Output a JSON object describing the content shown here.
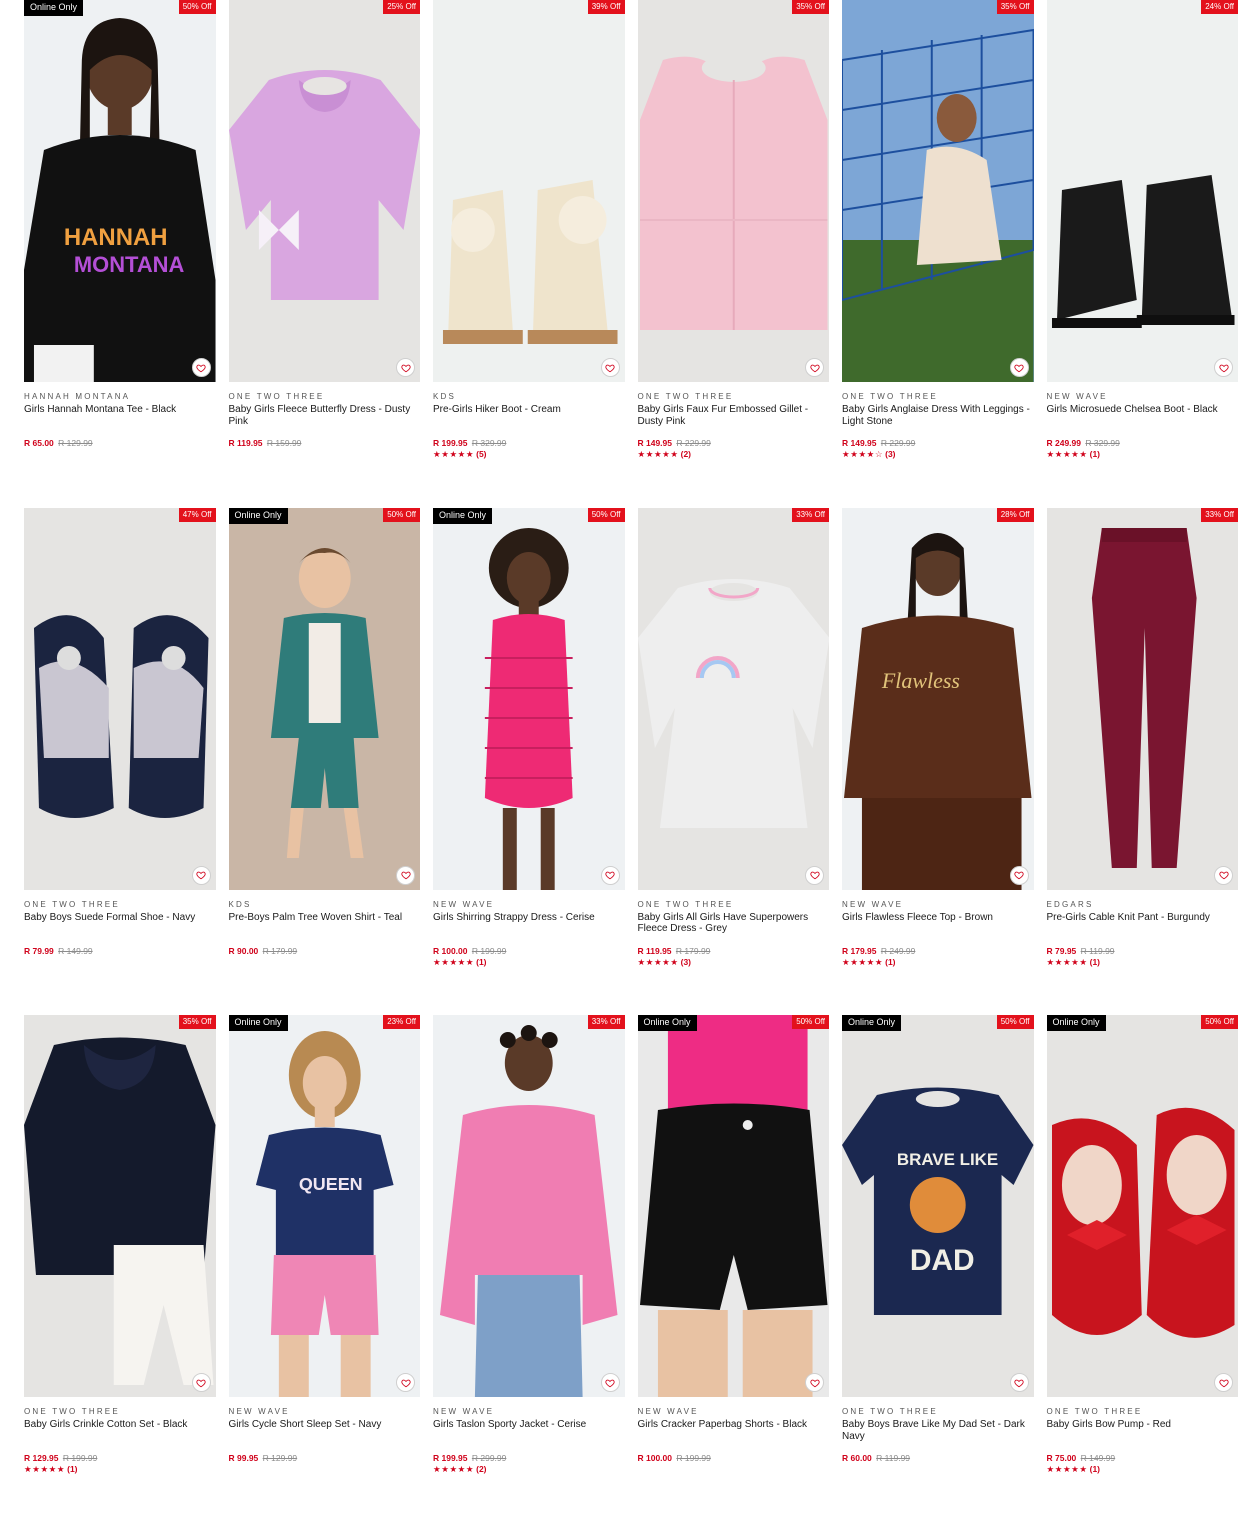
{
  "colors": {
    "sale_red": "#e3111c",
    "price_red": "#d0021b",
    "badge_black": "#000000"
  },
  "icons": {
    "wishlist": "heart-outline-icon",
    "rating": "star-icon"
  },
  "products": [
    {
      "id": "p1",
      "brand": "HANNAH MONTANA",
      "name": "Girls Hannah Montana Tee - Black",
      "price": "R 65.00",
      "was": "R 129.99",
      "discount": "50% Off",
      "online_only": "Online Only",
      "stars": "",
      "reviews": "",
      "bg": "#eef1f3",
      "art": "girl-tee"
    },
    {
      "id": "p2",
      "brand": "ONE TWO THREE",
      "name": "Baby Girls Fleece Butterfly Dress - Dusty Pink",
      "price": "R 119.95",
      "was": "R 159.99",
      "discount": "25% Off",
      "online_only": "",
      "stars": "",
      "reviews": "",
      "bg": "#e5e4e2",
      "art": "pink-dress"
    },
    {
      "id": "p3",
      "brand": "KDS",
      "name": "Pre-Girls Hiker Boot - Cream",
      "price": "R 199.95",
      "was": "R 329.99",
      "discount": "39% Off",
      "online_only": "",
      "stars": "★★★★★",
      "reviews": "(5)",
      "bg": "#eef1f0",
      "art": "boots-cream"
    },
    {
      "id": "p4",
      "brand": "ONE TWO THREE",
      "name": "Baby Girls Faux Fur Embossed Gillet - Dusty Pink",
      "price": "R 149.95",
      "was": "R 229.99",
      "discount": "35% Off",
      "online_only": "",
      "stars": "★★★★★",
      "reviews": "(2)",
      "bg": "#e5e4e2",
      "art": "pink-gillet"
    },
    {
      "id": "p5",
      "brand": "ONE TWO THREE",
      "name": "Baby Girls Anglaise Dress With Leggings - Light Stone",
      "price": "R 149.95",
      "was": "R 229.99",
      "discount": "35% Off",
      "online_only": "",
      "stars": "★★★★☆",
      "reviews": "(3)",
      "bg": "#7da6d6",
      "art": "playground"
    },
    {
      "id": "p6",
      "brand": "NEW WAVE",
      "name": "Girls Microsuede Chelsea Boot - Black",
      "price": "R 249.99",
      "was": "R 329.99",
      "discount": "24% Off",
      "online_only": "",
      "stars": "★★★★★",
      "reviews": "(1)",
      "bg": "#eef1f0",
      "art": "boots-black"
    },
    {
      "id": "p7",
      "brand": "ONE TWO THREE",
      "name": "Baby Boys Suede Formal Shoe - Navy",
      "price": "R 79.99",
      "was": "R 149.99",
      "discount": "47% Off",
      "online_only": "",
      "stars": "",
      "reviews": "",
      "bg": "#e5e4e2",
      "art": "navy-shoes"
    },
    {
      "id": "p8",
      "brand": "KDS",
      "name": "Pre-Boys Palm Tree Woven Shirt - Teal",
      "price": "R 90.00",
      "was": "R 179.99",
      "discount": "50% Off",
      "online_only": "Online Only",
      "stars": "",
      "reviews": "",
      "bg": "#c9b6a6",
      "art": "boy-teal"
    },
    {
      "id": "p9",
      "brand": "NEW WAVE",
      "name": "Girls Shirring Strappy Dress - Cerise",
      "price": "R 100.00",
      "was": "R 199.99",
      "discount": "50% Off",
      "online_only": "Online Only",
      "stars": "★★★★★",
      "reviews": "(1)",
      "bg": "#eef1f3",
      "art": "cerise-dress"
    },
    {
      "id": "p10",
      "brand": "ONE TWO THREE",
      "name": "Baby Girls All Girls Have Superpowers Fleece Dress - Grey",
      "price": "R 119.95",
      "was": "R 179.99",
      "discount": "33% Off",
      "online_only": "",
      "stars": "★★★★★",
      "reviews": "(3)",
      "bg": "#e5e4e2",
      "art": "grey-dress"
    },
    {
      "id": "p11",
      "brand": "NEW WAVE",
      "name": "Girls Flawless Fleece Top - Brown",
      "price": "R 179.95",
      "was": "R 249.99",
      "discount": "28% Off",
      "online_only": "",
      "stars": "★★★★★",
      "reviews": "(1)",
      "bg": "#eef1f3",
      "art": "brown-top"
    },
    {
      "id": "p12",
      "brand": "EDGARS",
      "name": "Pre-Girls Cable Knit Pant - Burgundy",
      "price": "R 79.95",
      "was": "R 119.99",
      "discount": "33% Off",
      "online_only": "",
      "stars": "★★★★★",
      "reviews": "(1)",
      "bg": "#e5e4e2",
      "art": "burgundy-pant"
    },
    {
      "id": "p13",
      "brand": "ONE TWO THREE",
      "name": "Baby Girls Crinkle Cotton Set - Black",
      "price": "R 129.95",
      "was": "R 199.99",
      "discount": "35% Off",
      "online_only": "",
      "stars": "★★★★★",
      "reviews": "(1)",
      "bg": "#e5e4e2",
      "art": "black-set"
    },
    {
      "id": "p14",
      "brand": "NEW WAVE",
      "name": "Girls Cycle Short Sleep Set - Navy",
      "price": "R 99.95",
      "was": "R 129.99",
      "discount": "23% Off",
      "online_only": "Online Only",
      "stars": "",
      "reviews": "",
      "bg": "#eef1f3",
      "art": "navy-sleep"
    },
    {
      "id": "p15",
      "brand": "NEW WAVE",
      "name": "Girls Taslon Sporty Jacket - Cerise",
      "price": "R 199.95",
      "was": "R 299.99",
      "discount": "33% Off",
      "online_only": "",
      "stars": "★★★★★",
      "reviews": "(2)",
      "bg": "#eef1f3",
      "art": "pink-jacket"
    },
    {
      "id": "p16",
      "brand": "NEW WAVE",
      "name": "Girls Cracker Paperbag Shorts - Black",
      "price": "R 100.00",
      "was": "R 199.99",
      "discount": "50% Off",
      "online_only": "Online Only",
      "stars": "",
      "reviews": "",
      "bg": "#e9e9e9",
      "art": "black-shorts"
    },
    {
      "id": "p17",
      "brand": "ONE TWO THREE",
      "name": "Baby Boys Brave Like My Dad Set - Dark Navy",
      "price": "R 60.00",
      "was": "R 119.99",
      "discount": "50% Off",
      "online_only": "Online Only",
      "stars": "",
      "reviews": "",
      "bg": "#e5e4e2",
      "art": "navy-tee"
    },
    {
      "id": "p18",
      "brand": "ONE TWO THREE",
      "name": "Baby Girls Bow Pump - Red",
      "price": "R 75.00",
      "was": "R 149.99",
      "discount": "50% Off",
      "online_only": "Online Only",
      "stars": "★★★★★",
      "reviews": "(1)",
      "bg": "#e5e4e2",
      "art": "red-pumps"
    }
  ]
}
